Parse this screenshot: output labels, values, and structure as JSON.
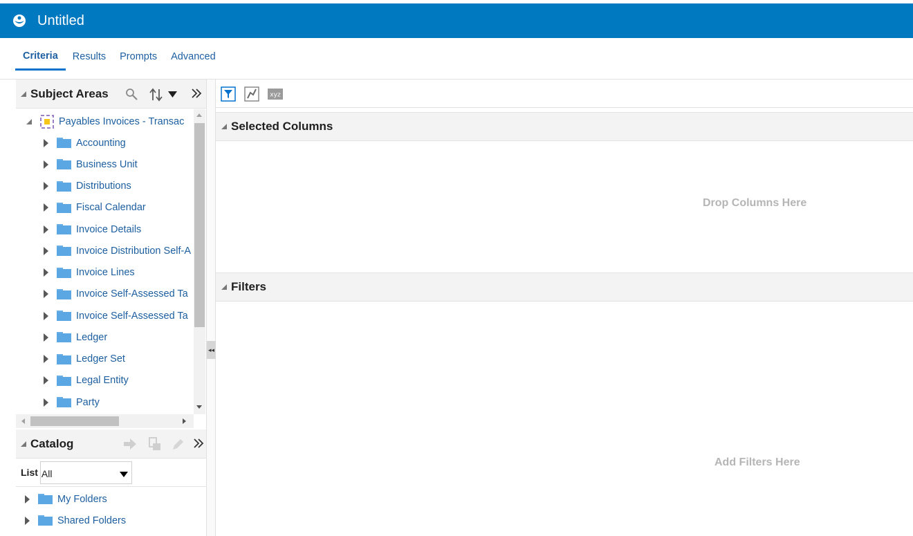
{
  "app": {
    "title": "Untitled"
  },
  "tabs": [
    {
      "label": "Criteria",
      "active": true
    },
    {
      "label": "Results"
    },
    {
      "label": "Prompts"
    },
    {
      "label": "Advanced"
    }
  ],
  "subject_areas": {
    "title": "Subject Areas",
    "root": "Payables Invoices - Transac",
    "folders": [
      "Accounting",
      "Business Unit",
      "Distributions",
      "Fiscal Calendar",
      "Invoice Details",
      "Invoice Distribution Self-A",
      "Invoice Lines",
      "Invoice Self-Assessed Ta",
      "Invoice Self-Assessed Ta",
      "Ledger",
      "Ledger Set",
      "Legal Entity",
      "Party"
    ]
  },
  "catalog": {
    "title": "Catalog",
    "list_label": "List",
    "list_value": "All",
    "folders": [
      "My Folders",
      "Shared Folders"
    ]
  },
  "criteria": {
    "selected_columns": {
      "title": "Selected Columns",
      "hint": "Drop Columns Here"
    },
    "filters": {
      "title": "Filters",
      "hint": "Add Filters Here"
    }
  },
  "colors": {
    "header": "#0079c1",
    "link": "#1d5fa0",
    "folder": "#5aa7e4"
  }
}
